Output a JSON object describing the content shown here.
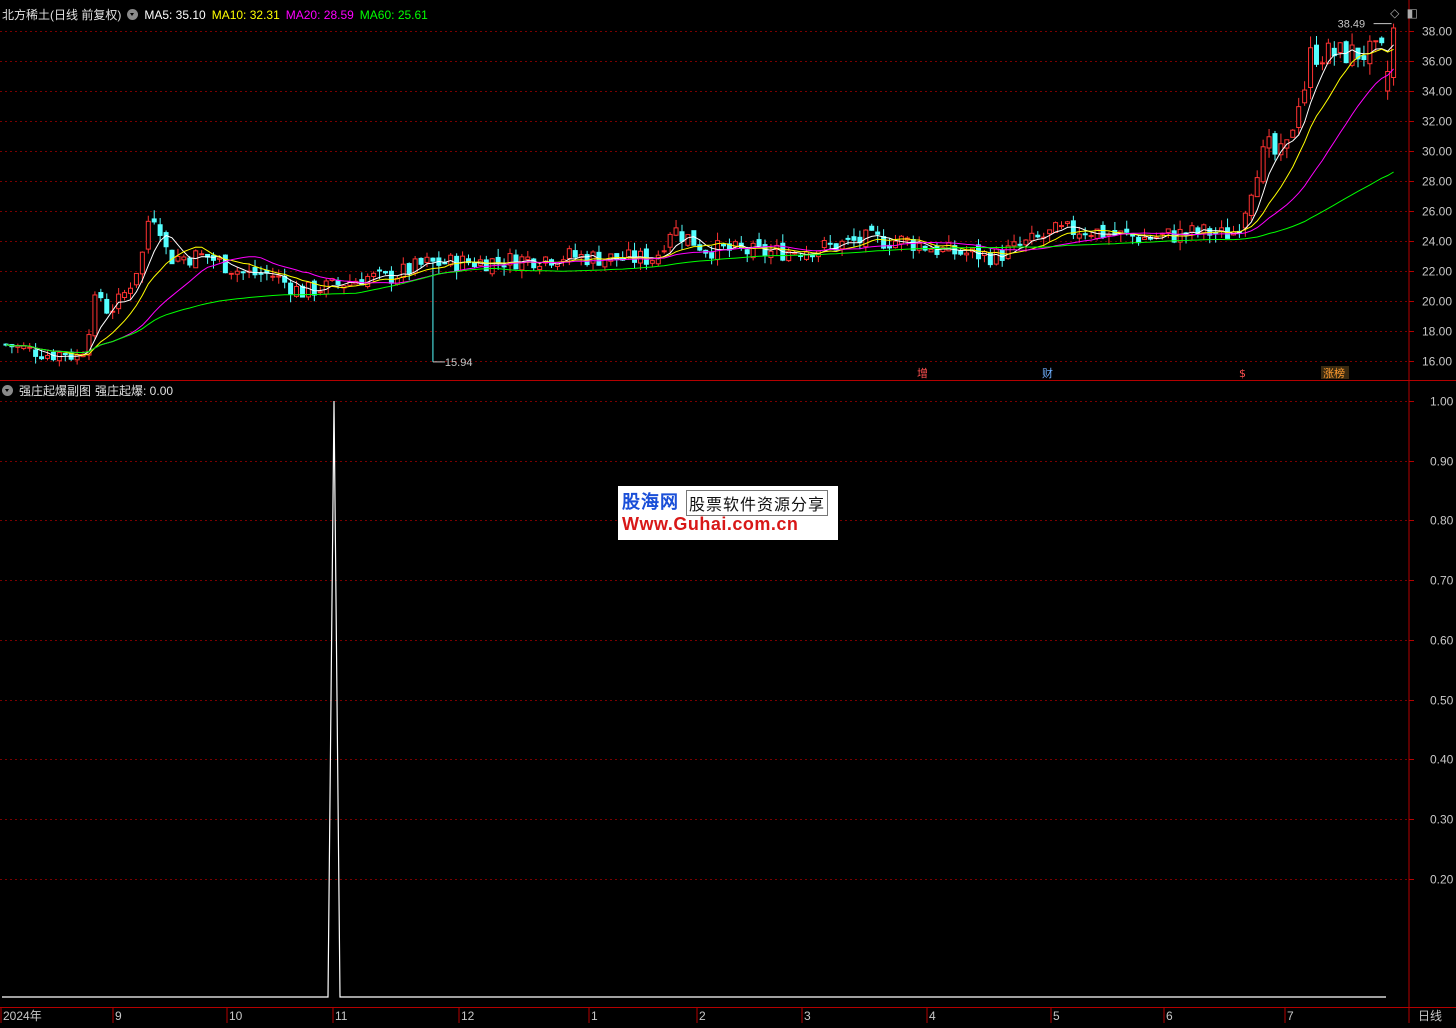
{
  "header": {
    "title": "北方稀土(日线 前复权)",
    "ma5": "MA5: 35.10",
    "ma10": "MA10: 32.31",
    "ma20": "MA20: 28.59",
    "ma60": "MA60: 25.61"
  },
  "colors": {
    "up": "#ff3232",
    "down": "#54ffff",
    "ma5": "#ffffff",
    "ma10": "#ffff00",
    "ma20": "#ff00ff",
    "ma60": "#00ff00",
    "grid": "#7a0000",
    "axis": "#b40000"
  },
  "price_axis": {
    "ticks": [
      "38.00",
      "36.00",
      "34.00",
      "32.00",
      "30.00",
      "28.00",
      "26.00",
      "24.00",
      "22.00",
      "20.00",
      "18.00",
      "16.00"
    ],
    "high_label": "38.49",
    "low_label": "15.94"
  },
  "events": [
    {
      "label": "增",
      "color": "#ff5050"
    },
    {
      "label": "财",
      "color": "#6fb0ff"
    },
    {
      "label": "$",
      "color": "#ff5050"
    },
    {
      "label": "涨榜",
      "color": "#ff9b2f"
    }
  ],
  "sub_panel": {
    "title": "强庄起爆副图",
    "indicator": "强庄起爆: 0.00",
    "ticks": [
      "1.00",
      "0.90",
      "0.80",
      "0.70",
      "0.60",
      "0.50",
      "0.40",
      "0.30",
      "0.20"
    ],
    "spike_value": 1.0
  },
  "time_axis": {
    "labels": [
      "2024年",
      "9",
      "10",
      "11",
      "12",
      "1",
      "2",
      "3",
      "4",
      "5",
      "6",
      "7"
    ]
  },
  "period_label": "日线",
  "watermark": {
    "brand": "股海网",
    "slogan": "股票软件资源分享",
    "url": "Www.Guhai.com.cn"
  }
}
